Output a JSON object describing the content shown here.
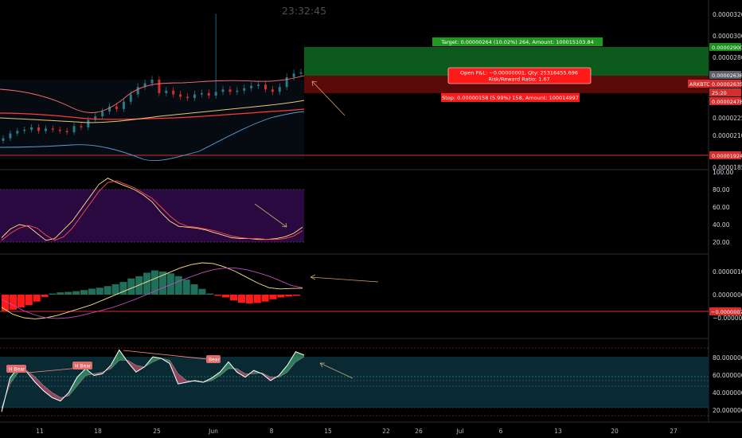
{
  "clock": "23:32:45",
  "colors": {
    "bg": "#000000",
    "axis_text": "#d1d4dc",
    "up": "#2a7a8a",
    "down": "#d32f2f",
    "green_zone": "#0b5a1b",
    "red_zone": "#5c0909",
    "stoch_band": "#2a0840",
    "mfi_band": "#0a2a33",
    "hist_pos": "#1f6f5a",
    "hist_neg": "#ff1a1a",
    "signal_line": "#ffe08a",
    "macd_line": "#c04ac0"
  },
  "price_axis": {
    "ticks": [
      "0.00003200",
      "0.00003000",
      "0.00002800",
      "0.00002250",
      "0.00002100",
      "0.00001850"
    ],
    "badges": [
      {
        "text": "0.00002900",
        "bg": "#1b8f1b",
        "fg": "#ffffff"
      },
      {
        "text": "0.00002636",
        "bg": "#5d606b",
        "fg": "#ffffff"
      },
      {
        "text": "ARKBTC",
        "bg": "#d32f2f",
        "fg": "#ffffff"
      },
      {
        "text": "0.00002635",
        "bg": "#d32f2f",
        "fg": "#ffffff"
      },
      {
        "text": "25:20",
        "bg": "#d32f2f",
        "fg": "#ffffff"
      },
      {
        "text": "0.00002478",
        "bg": "#d32f2f",
        "fg": "#ffffff"
      },
      {
        "text": "0.00001924",
        "bg": "#d32f2f",
        "fg": "#ffffff"
      }
    ]
  },
  "position": {
    "target_label": "Target: 0.00000264 (10.02%) 264, Amount: 100015103.84",
    "pnl_label": "Open P&L: −0.00000001, Qty: 25316455.696",
    "rr_label": "Risk/Reward Ratio: 1.67",
    "stop_label": "Stop: 0.00000158 (5.99%) 158, Amount: 100014997"
  },
  "stoch_axis": {
    "ticks": [
      "100.00",
      "80.00",
      "60.00",
      "40.00",
      "20.00"
    ]
  },
  "macd_axis": {
    "ticks": [
      "0.00000100",
      "0.00000000",
      "−0.00000100"
    ],
    "badge": "−0.00000071"
  },
  "mfi_axis": {
    "ticks": [
      "80.00000000",
      "60.00000000",
      "40.00000000",
      "20.00000000"
    ]
  },
  "divergence_labels": [
    "H Bear",
    "H Bear",
    "Bear"
  ],
  "time_axis": {
    "labels": [
      "11",
      "18",
      "25",
      "Jun",
      "8",
      "15",
      "22",
      "26",
      "Jul",
      "6",
      "13",
      "20",
      "27"
    ]
  },
  "chart_data": [
    {
      "type": "candlestick",
      "title": "",
      "symbol": "ARKBTC",
      "series": [
        {
          "name": "",
          "values": [
            2.1e-05,
            2.14e-05,
            2.16e-05,
            2.17e-05,
            2.19e-05,
            2.16e-05,
            2.18e-05,
            2.17e-05,
            2.16e-05,
            2.15e-05,
            2.2e-05,
            2.19e-05,
            2.25e-05,
            2.28e-05,
            2.32e-05,
            2.36e-05,
            2.34e-05,
            2.4e-05,
            2.46e-05,
            2.52e-05,
            2.55e-05,
            2.58e-05,
            2.47e-05,
            2.49e-05,
            2.46e-05,
            2.44e-05,
            2.43e-05,
            2.46e-05,
            2.47e-05,
            2.45e-05,
            2.48e-05,
            2.5e-05,
            2.48e-05,
            2.49e-05,
            2.51e-05,
            2.53e-05,
            2.54e-05,
            2.5e-05,
            2.48e-05,
            2.52e-05,
            2.6e-05,
            2.63e-05,
            2.64e-05
          ]
        }
      ],
      "lines": [
        "bollinger-upper",
        "bollinger-lower",
        "moving-average-red",
        "moving-average-yellow"
      ],
      "horizontal_level": 1.924e-05
    },
    {
      "type": "line",
      "title": "",
      "ylim": [
        0,
        100
      ],
      "band": [
        20,
        80
      ],
      "series": [
        {
          "name": "",
          "values": [
            25,
            35,
            40,
            38,
            30,
            22,
            24,
            34,
            44,
            58,
            72,
            86,
            93,
            88,
            84,
            80,
            74,
            66,
            54,
            44,
            38,
            37,
            36,
            34,
            31,
            28,
            25,
            24,
            24,
            23,
            23,
            24,
            26,
            30,
            37
          ]
        },
        {
          "name": "",
          "values": [
            22,
            30,
            36,
            39,
            36,
            28,
            22,
            26,
            36,
            50,
            64,
            78,
            88,
            90,
            86,
            82,
            76,
            70,
            60,
            50,
            42,
            38,
            37,
            35,
            33,
            30,
            27,
            25,
            24,
            24,
            23,
            23,
            24,
            27,
            33
          ]
        }
      ]
    },
    {
      "type": "bar",
      "title": "",
      "histogram": [
        -0.7,
        -0.65,
        -0.55,
        -0.45,
        -0.3,
        -0.1,
        0.05,
        0.1,
        0.12,
        0.15,
        0.2,
        0.26,
        0.3,
        0.37,
        0.45,
        0.55,
        0.7,
        0.8,
        0.95,
        1.05,
        1.0,
        0.92,
        0.8,
        0.65,
        0.45,
        0.25,
        0.05,
        -0.05,
        -0.12,
        -0.25,
        -0.35,
        -0.38,
        -0.36,
        -0.3,
        -0.2,
        -0.12,
        -0.08,
        -0.05
      ],
      "series": [
        {
          "name": "",
          "values": [
            -0.55,
            -0.85,
            -1.0,
            -1.05,
            -1.0,
            -0.9,
            -0.75,
            -0.6,
            -0.45,
            -0.25,
            -0.05,
            0.15,
            0.35,
            0.55,
            0.75,
            0.95,
            1.15,
            1.3,
            1.38,
            1.35,
            1.2,
            1.0,
            0.75,
            0.5,
            0.3,
            0.25,
            0.27,
            0.28
          ]
        },
        {
          "name": "",
          "values": [
            -0.2,
            -0.45,
            -0.7,
            -0.88,
            -1.0,
            -1.03,
            -1.0,
            -0.92,
            -0.8,
            -0.68,
            -0.55,
            -0.38,
            -0.2,
            0,
            0.2,
            0.4,
            0.6,
            0.78,
            0.95,
            1.08,
            1.15,
            1.15,
            1.08,
            0.95,
            0.8,
            0.6,
            0.4,
            0.3
          ]
        }
      ]
    },
    {
      "type": "area",
      "title": "",
      "ylim": [
        0,
        100
      ],
      "band": [
        50,
        80
      ],
      "series": [
        {
          "name": "",
          "values": [
            15,
            55,
            68,
            62,
            50,
            40,
            32,
            28,
            38,
            56,
            66,
            58,
            60,
            70,
            88,
            74,
            62,
            68,
            80,
            78,
            72,
            48,
            50,
            52,
            50,
            55,
            62,
            74,
            62,
            56,
            64,
            60,
            52,
            58,
            70,
            86,
            82
          ]
        },
        {
          "name": "",
          "values": [
            20,
            48,
            62,
            64,
            56,
            46,
            38,
            32,
            34,
            46,
            58,
            60,
            62,
            66,
            76,
            76,
            70,
            68,
            74,
            78,
            76,
            60,
            52,
            51,
            50,
            52,
            58,
            66,
            66,
            60,
            60,
            61,
            56,
            56,
            62,
            74,
            80
          ]
        }
      ]
    }
  ]
}
